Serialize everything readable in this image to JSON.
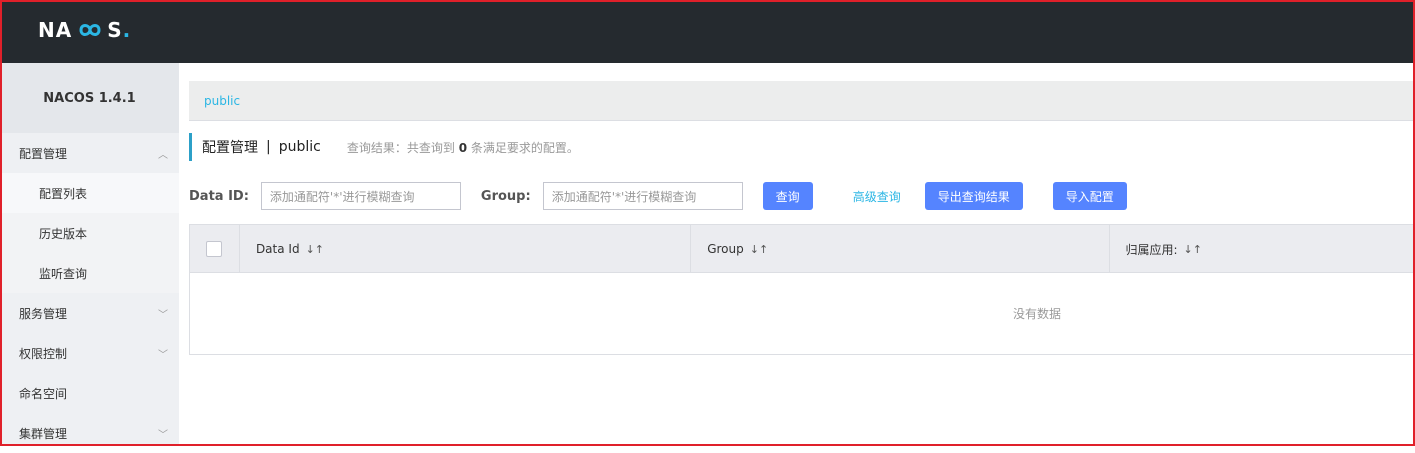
{
  "header": {
    "logo_text_left": "NA",
    "logo_text_right": "S",
    "logo_dot": "."
  },
  "sidebar": {
    "version": "NACOS 1.4.1",
    "items": [
      {
        "label": "配置管理",
        "expanded": true
      },
      {
        "label": "配置列表",
        "sub": true,
        "active": true
      },
      {
        "label": "历史版本",
        "sub": true
      },
      {
        "label": "监听查询",
        "sub": true
      },
      {
        "label": "服务管理",
        "expanded": false
      },
      {
        "label": "权限控制",
        "expanded": false
      },
      {
        "label": "命名空间"
      },
      {
        "label": "集群管理",
        "expanded": false
      }
    ]
  },
  "namespace_bar": {
    "current": "public"
  },
  "page": {
    "title": "配置管理",
    "separator": "|",
    "namespace": "public",
    "result_prefix": "查询结果：共查询到",
    "result_count": "0",
    "result_suffix": "条满足要求的配置。"
  },
  "search": {
    "dataid_label": "Data ID:",
    "dataid_placeholder": "添加通配符'*'进行模糊查询",
    "group_label": "Group:",
    "group_placeholder": "添加通配符'*'进行模糊查询",
    "query_button": "查询",
    "advanced_link": "高级查询",
    "export_button": "导出查询结果",
    "import_button": "导入配置"
  },
  "table": {
    "columns": [
      "Data Id",
      "Group",
      "归属应用:"
    ],
    "empty_text": "没有数据"
  },
  "colors": {
    "accent": "#5584ff",
    "link": "#2bb6e4",
    "header_bg": "#252a2f"
  }
}
